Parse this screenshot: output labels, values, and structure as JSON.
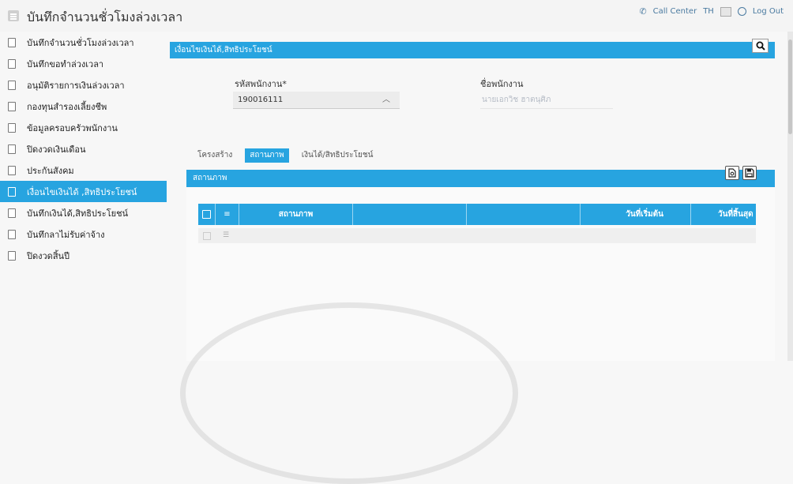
{
  "header": {
    "title": "บันทึกจำนวนชั่วโมงล่วงเวลา",
    "call_center": "Call Center",
    "language": "TH",
    "logout": "Log Out"
  },
  "sidebar": {
    "items": [
      {
        "label": "บันทึกจำนวนชั่วโมงล่วงเวลา",
        "icon": "document-icon"
      },
      {
        "label": "บันทึกขอทำล่วงเวลา",
        "icon": "document-icon"
      },
      {
        "label": "อนุมัติรายการเงินล่วงเวลา",
        "icon": "document-icon"
      },
      {
        "label": "กองทุนสำรองเลี้ยงชีพ",
        "icon": "document-icon"
      },
      {
        "label": "ข้อมูลครอบครัวพนักงาน",
        "icon": "document-icon"
      },
      {
        "label": "ปิดงวดเงินเดือน",
        "icon": "document-icon"
      },
      {
        "label": "ประกันสังคม",
        "icon": "document-icon"
      },
      {
        "label": "เงื่อนไขเงินได้ ,สิทธิประโยชน์",
        "icon": "document-icon",
        "active": true
      },
      {
        "label": "บันทึกเงินได้,สิทธิประโยชน์",
        "icon": "document-icon"
      },
      {
        "label": "บันทึกลาไม่รับค่าจ้าง",
        "icon": "document-icon"
      },
      {
        "label": "ปิดงวดสิ้นปี",
        "icon": "document-icon"
      }
    ]
  },
  "panel": {
    "title": "เงื่อนไขเงินได้,สิทธิประโยชน์",
    "employee_code_label": "รหัสพนักงาน*",
    "employee_code_value": "190016111",
    "employee_name_label": "ชื่อพนักงาน",
    "employee_name_value": "นายเอกวิช ฮาตนุศิภ"
  },
  "tabs": [
    {
      "label": "โครงสร้าง"
    },
    {
      "label": "สถานภาพ",
      "active": true
    },
    {
      "label": "เงินได้/สิทธิประโยชน์"
    }
  ],
  "subsection": {
    "title": "สถานภาพ"
  },
  "grid": {
    "columns": [
      "",
      "",
      "สถานภาพ",
      "",
      "",
      "วันที่เริ่มต้น",
      "วันที่สิ้นสุด"
    ],
    "rows": [
      [
        "",
        "",
        "",
        "",
        "",
        "",
        ""
      ]
    ]
  },
  "colors": {
    "accent": "#27a4e0",
    "background": "#f7f7f7",
    "link": "#4a7aa0"
  }
}
